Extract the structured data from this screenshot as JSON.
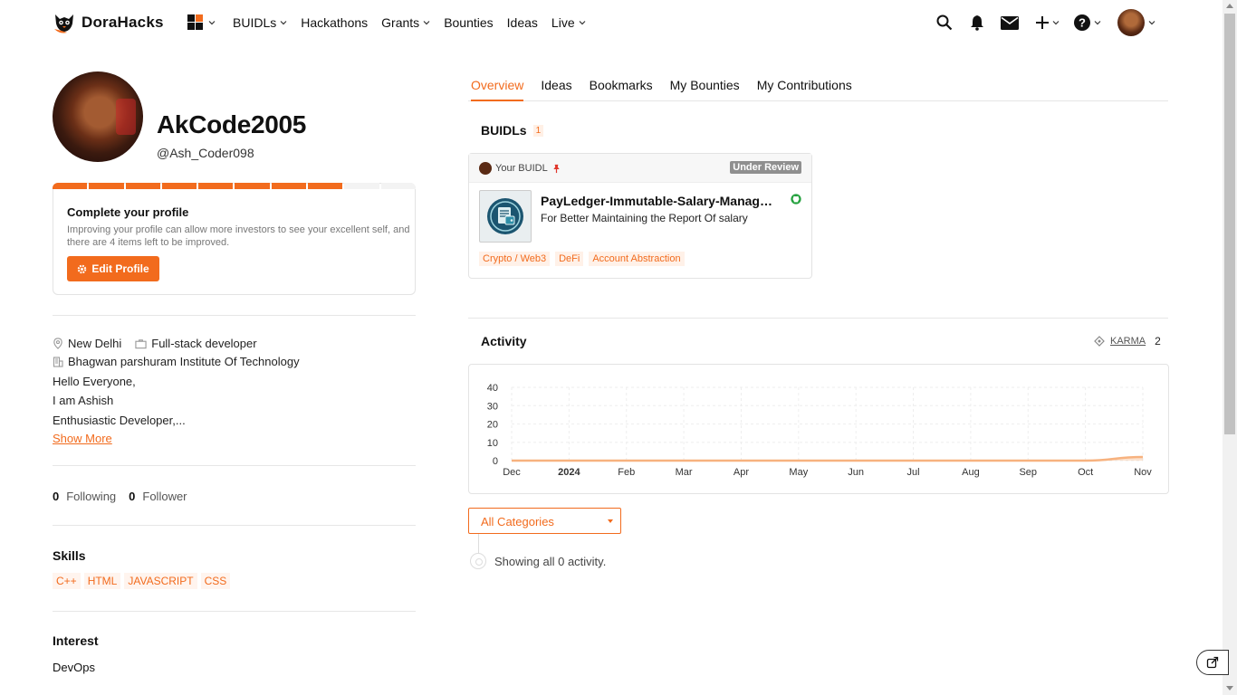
{
  "brand": {
    "name": "DoraHacks",
    "accent": "#f26b1d"
  },
  "nav": {
    "links": [
      {
        "label": "BUIDLs",
        "dropdown": true
      },
      {
        "label": "Hackathons",
        "dropdown": false
      },
      {
        "label": "Grants",
        "dropdown": true
      },
      {
        "label": "Bounties",
        "dropdown": false
      },
      {
        "label": "Ideas",
        "dropdown": false
      },
      {
        "label": "Live",
        "dropdown": true
      }
    ],
    "icons": [
      "search-icon",
      "bell-icon",
      "mail-icon",
      "plus-icon",
      "help-icon",
      "avatar"
    ]
  },
  "profile": {
    "name": "AkCode2005",
    "handle": "@Ash_Coder098",
    "completion": {
      "filled_segments": 8,
      "total_segments": 10
    },
    "complete_title": "Complete your profile",
    "complete_desc": "Improving your profile can allow more investors to see your excellent self, and there are 4 items left to be improved.",
    "edit_label": "Edit Profile",
    "location": "New Delhi",
    "role": "Full-stack developer",
    "school": "Bhagwan parshuram Institute Of Technology",
    "bio": [
      "Hello Everyone,",
      "I am Ashish",
      "Enthusiastic Developer,..."
    ],
    "show_more": "Show More",
    "following_count": "0",
    "following_label": "Following",
    "follower_count": "0",
    "follower_label": "Follower",
    "skills_title": "Skills",
    "skills": [
      "C++",
      "HTML",
      "JAVASCRIPT",
      "CSS"
    ],
    "interest_title": "Interest",
    "interest": "DevOps"
  },
  "tabs": [
    "Overview",
    "Ideas",
    "Bookmarks",
    "My Bounties",
    "My Contributions"
  ],
  "active_tab": "Overview",
  "buidls": {
    "title": "BUIDLs",
    "count": "1",
    "card": {
      "owner_label": "Your BUIDL",
      "status": "Under Review",
      "title": "PayLedger-Immutable-Salary-Management",
      "subtitle": "For Better Maintaining the Report Of salary",
      "tags": [
        "Crypto / Web3",
        "DeFi",
        "Account Abstraction"
      ]
    }
  },
  "activity": {
    "title": "Activity",
    "karma_label": "KARMA",
    "karma_value": "2",
    "filter": "All Categories",
    "empty_text": "Showing all 0 activity."
  },
  "chart_data": {
    "type": "area",
    "x": [
      "Dec",
      "2024",
      "Feb",
      "Mar",
      "Apr",
      "May",
      "Jun",
      "Jul",
      "Aug",
      "Sep",
      "Oct",
      "Nov"
    ],
    "y_ticks": [
      0,
      10,
      20,
      30,
      40
    ],
    "ylim": [
      0,
      40
    ],
    "series": [
      {
        "values": [
          0,
          0,
          0,
          0,
          0,
          0,
          0,
          0,
          0,
          0,
          0,
          2
        ]
      }
    ],
    "grid": true,
    "color": "#f7b27f"
  }
}
